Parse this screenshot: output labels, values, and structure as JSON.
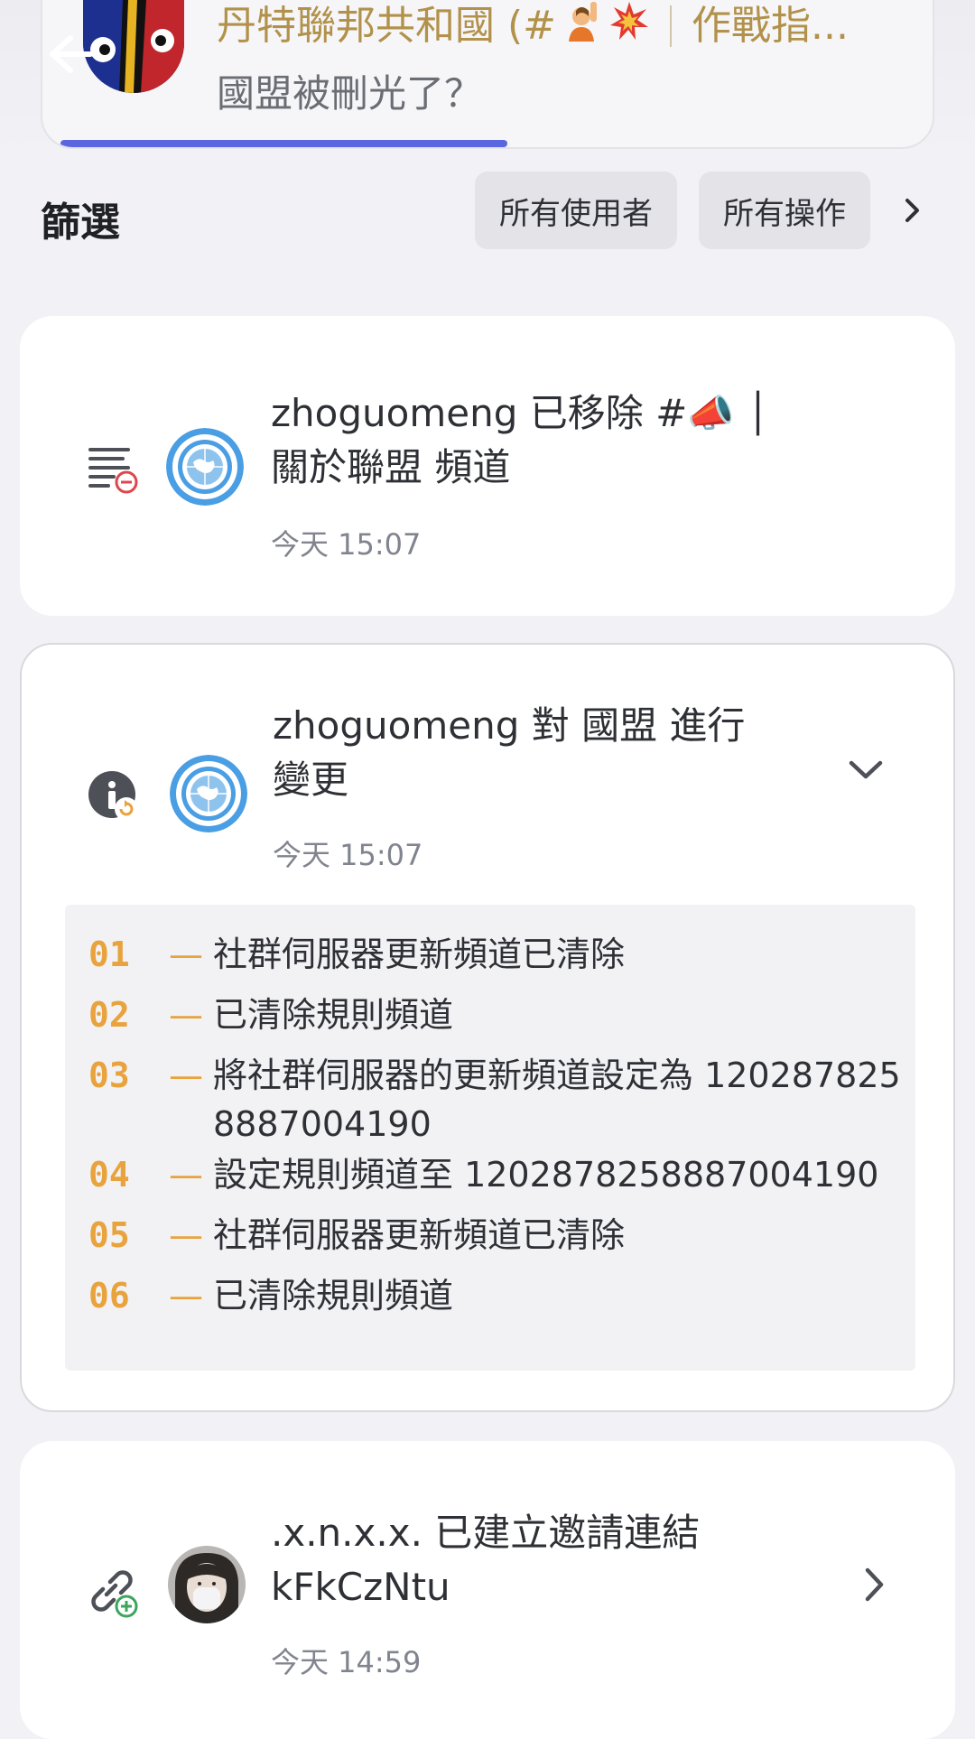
{
  "header": {
    "server_name": "丹特聯邦共和國 (#",
    "server_name_tail": "作戰指...",
    "channel_topic": "國盟被刪光了？",
    "emoji_icons": [
      "person-raising-hand-icon",
      "collision-icon"
    ]
  },
  "filter": {
    "label": "篩選",
    "users_chip": "所有使用者",
    "actions_chip": "所有操作"
  },
  "entries": [
    {
      "line1": "zhoguomeng 已移除 #📣 │",
      "line2": "關於聯盟 頻道",
      "time": "今天 15:07",
      "action_icon": "channel-delete-icon",
      "avatar": "un-globe-avatar"
    },
    {
      "line1": "zhoguomeng 對 國盟 進行",
      "line2": "變更",
      "time": "今天 15:07",
      "action_icon": "server-update-icon",
      "avatar": "un-globe-avatar",
      "changes": [
        {
          "num": "01",
          "text": "社群伺服器更新頻道已清除"
        },
        {
          "num": "02",
          "text": "已清除規則頻道"
        },
        {
          "num": "03",
          "text": "將社群伺服器的更新頻道設定為 1202878258887004190"
        },
        {
          "num": "04",
          "text": "設定規則頻道至 1202878258887004190"
        },
        {
          "num": "05",
          "text": "社群伺服器更新頻道已清除"
        },
        {
          "num": "06",
          "text": "已清除規則頻道"
        }
      ]
    },
    {
      "line1": ".x.n.x.x. 已建立邀請連結",
      "line2": "kFkCzNtu",
      "time": "今天 14:59",
      "action_icon": "invite-link-add-icon",
      "avatar": "masked-user-avatar"
    }
  ],
  "dash": "—",
  "colors": {
    "accent": "#5b67e0",
    "change_number": "#e8a33d",
    "server_name": "#b2924a",
    "delete_red": "#e0454d",
    "add_green": "#3ba55c"
  }
}
